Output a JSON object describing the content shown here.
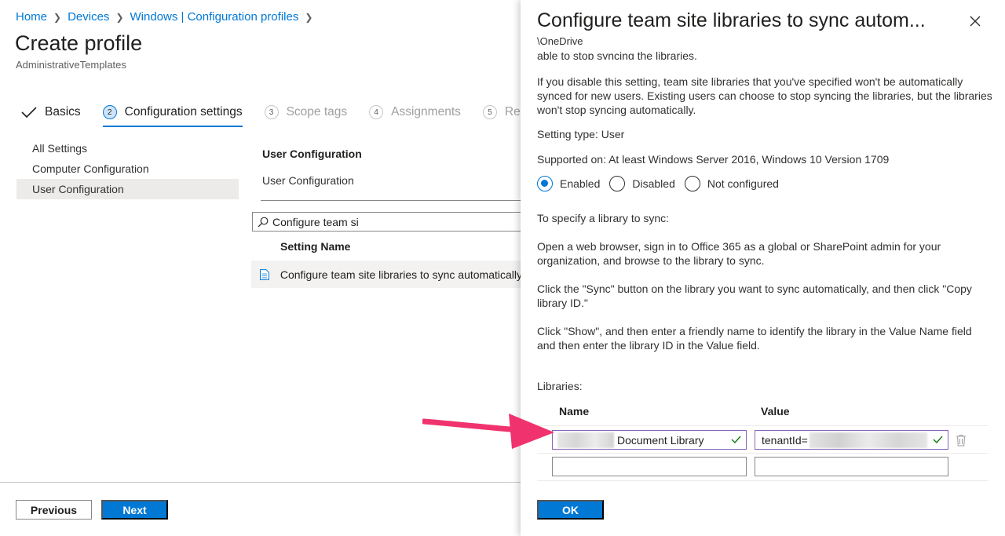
{
  "breadcrumb": [
    "Home",
    "Devices",
    "Windows | Configuration profiles"
  ],
  "page": {
    "title": "Create profile",
    "subtitle": "AdministrativeTemplates"
  },
  "steps": [
    {
      "label": "Basics",
      "state": "done"
    },
    {
      "num": "2",
      "label": "Configuration settings",
      "state": "active"
    },
    {
      "num": "3",
      "label": "Scope tags",
      "state": "pending"
    },
    {
      "num": "4",
      "label": "Assignments",
      "state": "pending"
    },
    {
      "num": "5",
      "label": "Review",
      "state": "pending"
    }
  ],
  "tree": [
    "All Settings",
    "Computer Configuration",
    "User Configuration"
  ],
  "config": {
    "heading": "User Configuration",
    "sub": "User Configuration"
  },
  "search": {
    "value": "Configure team si"
  },
  "results": {
    "column": "Setting Name",
    "rows": [
      "Configure team site libraries to sync automatically"
    ]
  },
  "footer": {
    "previous": "Previous",
    "next": "Next"
  },
  "panel": {
    "title": "Configure team site libraries to sync autom...",
    "path": "\\OneDrive",
    "cut_text": "able to stop syncing the libraries.",
    "para_disable": "If you disable this setting, team site libraries that you've specified won't be automatically synced for new users. Existing users can choose to stop syncing the libraries, but the libraries won't stop syncing automatically.",
    "setting_type": "Setting type: User",
    "supported": "Supported on: At least Windows Server 2016, Windows 10 Version 1709",
    "radios": [
      "Enabled",
      "Disabled",
      "Not configured"
    ],
    "selected_radio": "Enabled",
    "specify": "To specify a library to sync:",
    "step1": "Open a web browser, sign in to Office 365 as a global or SharePoint admin for your organization, and browse to the library to sync.",
    "step2": "Click the \"Sync\" button on the library you want to sync automatically, and then click \"Copy library ID.\"",
    "step3": "Click \"Show\", and then enter a friendly name to identify the library in the Value Name field and then enter the library ID in the Value field.",
    "libraries_label": "Libraries:",
    "col_name": "Name",
    "col_value": "Value",
    "row_name_value": "Document Library",
    "row_value_value": "tenantId=",
    "ok": "OK"
  },
  "colors": {
    "accent": "#0078d4",
    "annotation_arrow": "#f0336e"
  }
}
